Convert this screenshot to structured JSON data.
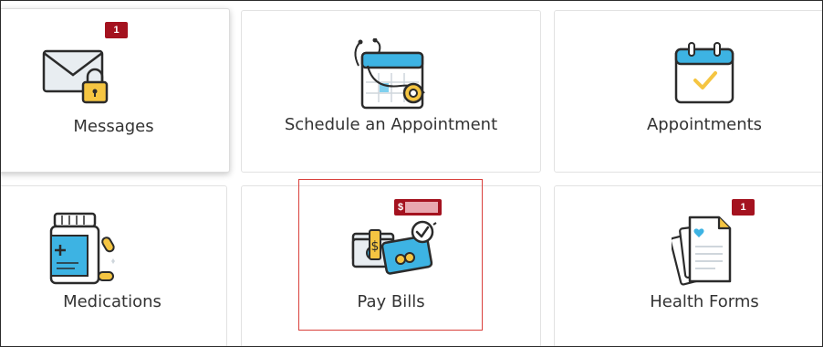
{
  "tiles": {
    "messages": {
      "label": "Messages",
      "badge": "1"
    },
    "schedule": {
      "label": "Schedule an Appointment"
    },
    "appointments": {
      "label": "Appointments"
    },
    "medications": {
      "label": "Medications"
    },
    "paybills": {
      "label": "Pay Bills",
      "badge": "$"
    },
    "healthforms": {
      "label": "Health Forms",
      "badge": "1"
    }
  },
  "icons": {
    "messages": "envelope-lock-icon",
    "schedule": "calendar-stethoscope-icon",
    "appointments": "calendar-check-icon",
    "medications": "pill-bottle-icon",
    "paybills": "money-card-icon",
    "healthforms": "forms-stack-icon"
  },
  "colors": {
    "badge": "#a4121f",
    "accent_blue": "#3db3e3",
    "accent_yellow": "#f5c542",
    "highlight": "#d9403c"
  }
}
